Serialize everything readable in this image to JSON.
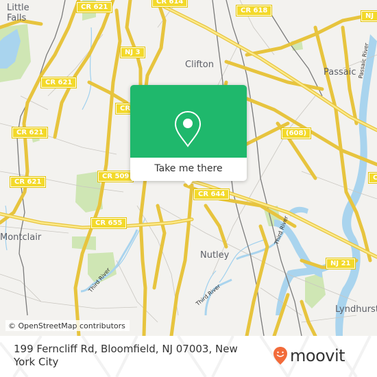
{
  "map": {
    "places": [
      "Little Falls",
      "Clifton",
      "Passaic",
      "Montclair",
      "Nutley",
      "Lyndhurst"
    ],
    "road_shields": [
      "CR 621",
      "CR 614",
      "CR 618",
      "NJ 3",
      "NJ",
      "CR 621",
      "CR",
      "CR 621",
      "CR 509",
      "CR 621",
      "CR 655",
      "CR 644",
      "(608)",
      "NJ 21",
      "C"
    ],
    "water_labels": [
      "Passaic River",
      "Third River",
      "Third River",
      "Third River"
    ],
    "attribution": "© OpenStreetMap contributors"
  },
  "popup": {
    "icon": "location-pin-icon",
    "button_label": "Take me there",
    "accent_color": "#1fb86c"
  },
  "footer": {
    "address": "199 Ferncliff Rd, Bloomfield, NJ 07003, New York City",
    "brand": "moovit",
    "brand_icon": "moovit-smiley-pin-icon",
    "brand_color": "#f26b3a"
  }
}
